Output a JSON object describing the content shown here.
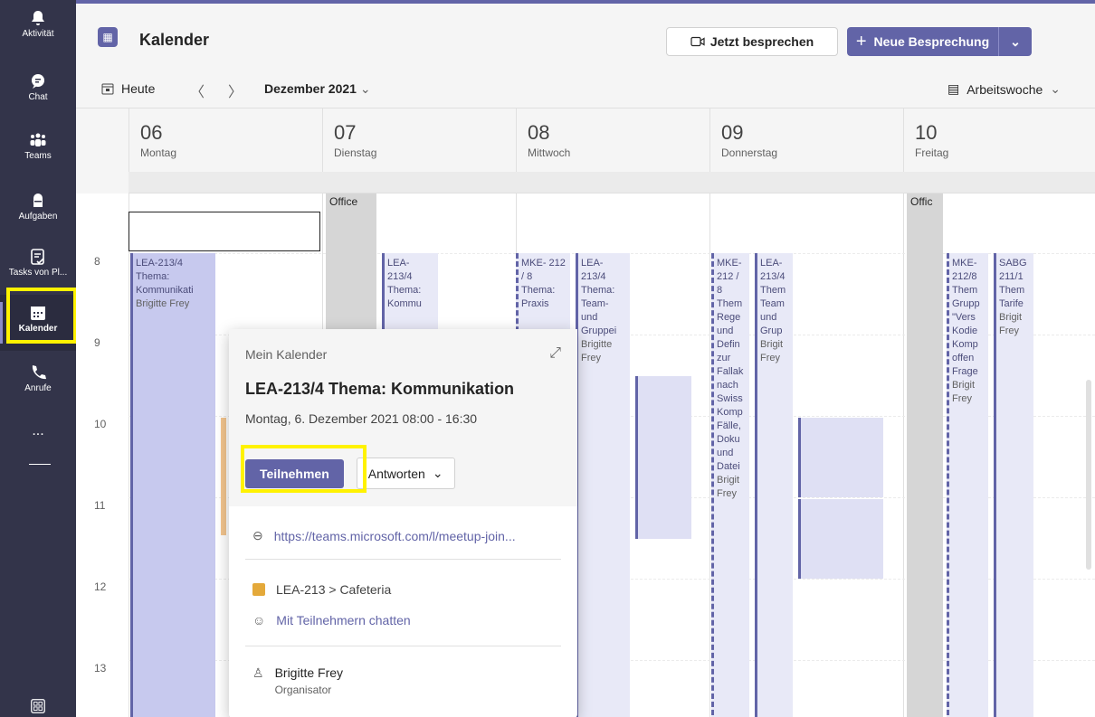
{
  "rail": {
    "items": [
      {
        "label": "Aktivität"
      },
      {
        "label": "Chat"
      },
      {
        "label": "Teams"
      },
      {
        "label": "Aufgaben"
      },
      {
        "label": "Tasks von Pl..."
      },
      {
        "label": "Kalender"
      },
      {
        "label": "Anrufe"
      },
      {
        "label": "..."
      }
    ]
  },
  "header": {
    "title": "Kalender",
    "meet_now": "Jetzt besprechen",
    "new_meeting": "Neue Besprechung"
  },
  "nav": {
    "today": "Heute",
    "month": "Dezember 2021",
    "view": "Arbeitswoche"
  },
  "days": [
    {
      "num": "06",
      "name": "Montag"
    },
    {
      "num": "07",
      "name": "Dienstag"
    },
    {
      "num": "08",
      "name": "Mittwoch"
    },
    {
      "num": "09",
      "name": "Donnerstag"
    },
    {
      "num": "10",
      "name": "Freitag"
    }
  ],
  "hours": [
    "8",
    "9",
    "10",
    "11",
    "12",
    "13"
  ],
  "events": {
    "mon_main": {
      "title": "LEA-213/4 Thema: Kommunikati",
      "org": "Brigitte Frey"
    },
    "office1": "Office",
    "office2": "Offic",
    "tue_lea": {
      "title": "LEA- 213/4 Thema: Kommu"
    },
    "wed_mke": {
      "title": "MKE- 212 / 8 Thema: Praxis"
    },
    "wed_lea": {
      "title": "LEA- 213/4 Thema: Team- und Gruppei",
      "org": "Brigitte Frey"
    },
    "thu_mke": {
      "title": "MKE- 212 / 8 Them Rege und Defin zur Fallak nach Swiss Komp Fälle, Doku und Datei",
      "org": "Brigit Frey"
    },
    "thu_lea": {
      "title": "LEA- 213/4 Them Team und Grup",
      "org": "Brigit Frey"
    },
    "fri_mke": {
      "title": "MKE- 212/8 Them Grupp \"Vers Kodie Komp offen Frage",
      "org": "Brigit Frey"
    },
    "fri_sabg": {
      "title": "SABG 211/1 Them Tarife",
      "org": "Brigit Frey"
    }
  },
  "popup": {
    "calendar": "Mein Kalender",
    "title": "LEA-213/4 Thema: Kommunikation",
    "time": "Montag, 6. Dezember 2021 08:00 - 16:30",
    "join": "Teilnehmen",
    "answer": "Antworten",
    "link": "https://teams.microsoft.com/l/meetup-join...",
    "channel": "LEA-213 > Cafeteria",
    "chat": "Mit Teilnehmern chatten",
    "organizer": "Brigitte Frey",
    "organizer_role": "Organisator"
  },
  "colors": {
    "brand": "#6264a7",
    "rail": "#33344a",
    "highlight": "#fff200"
  }
}
